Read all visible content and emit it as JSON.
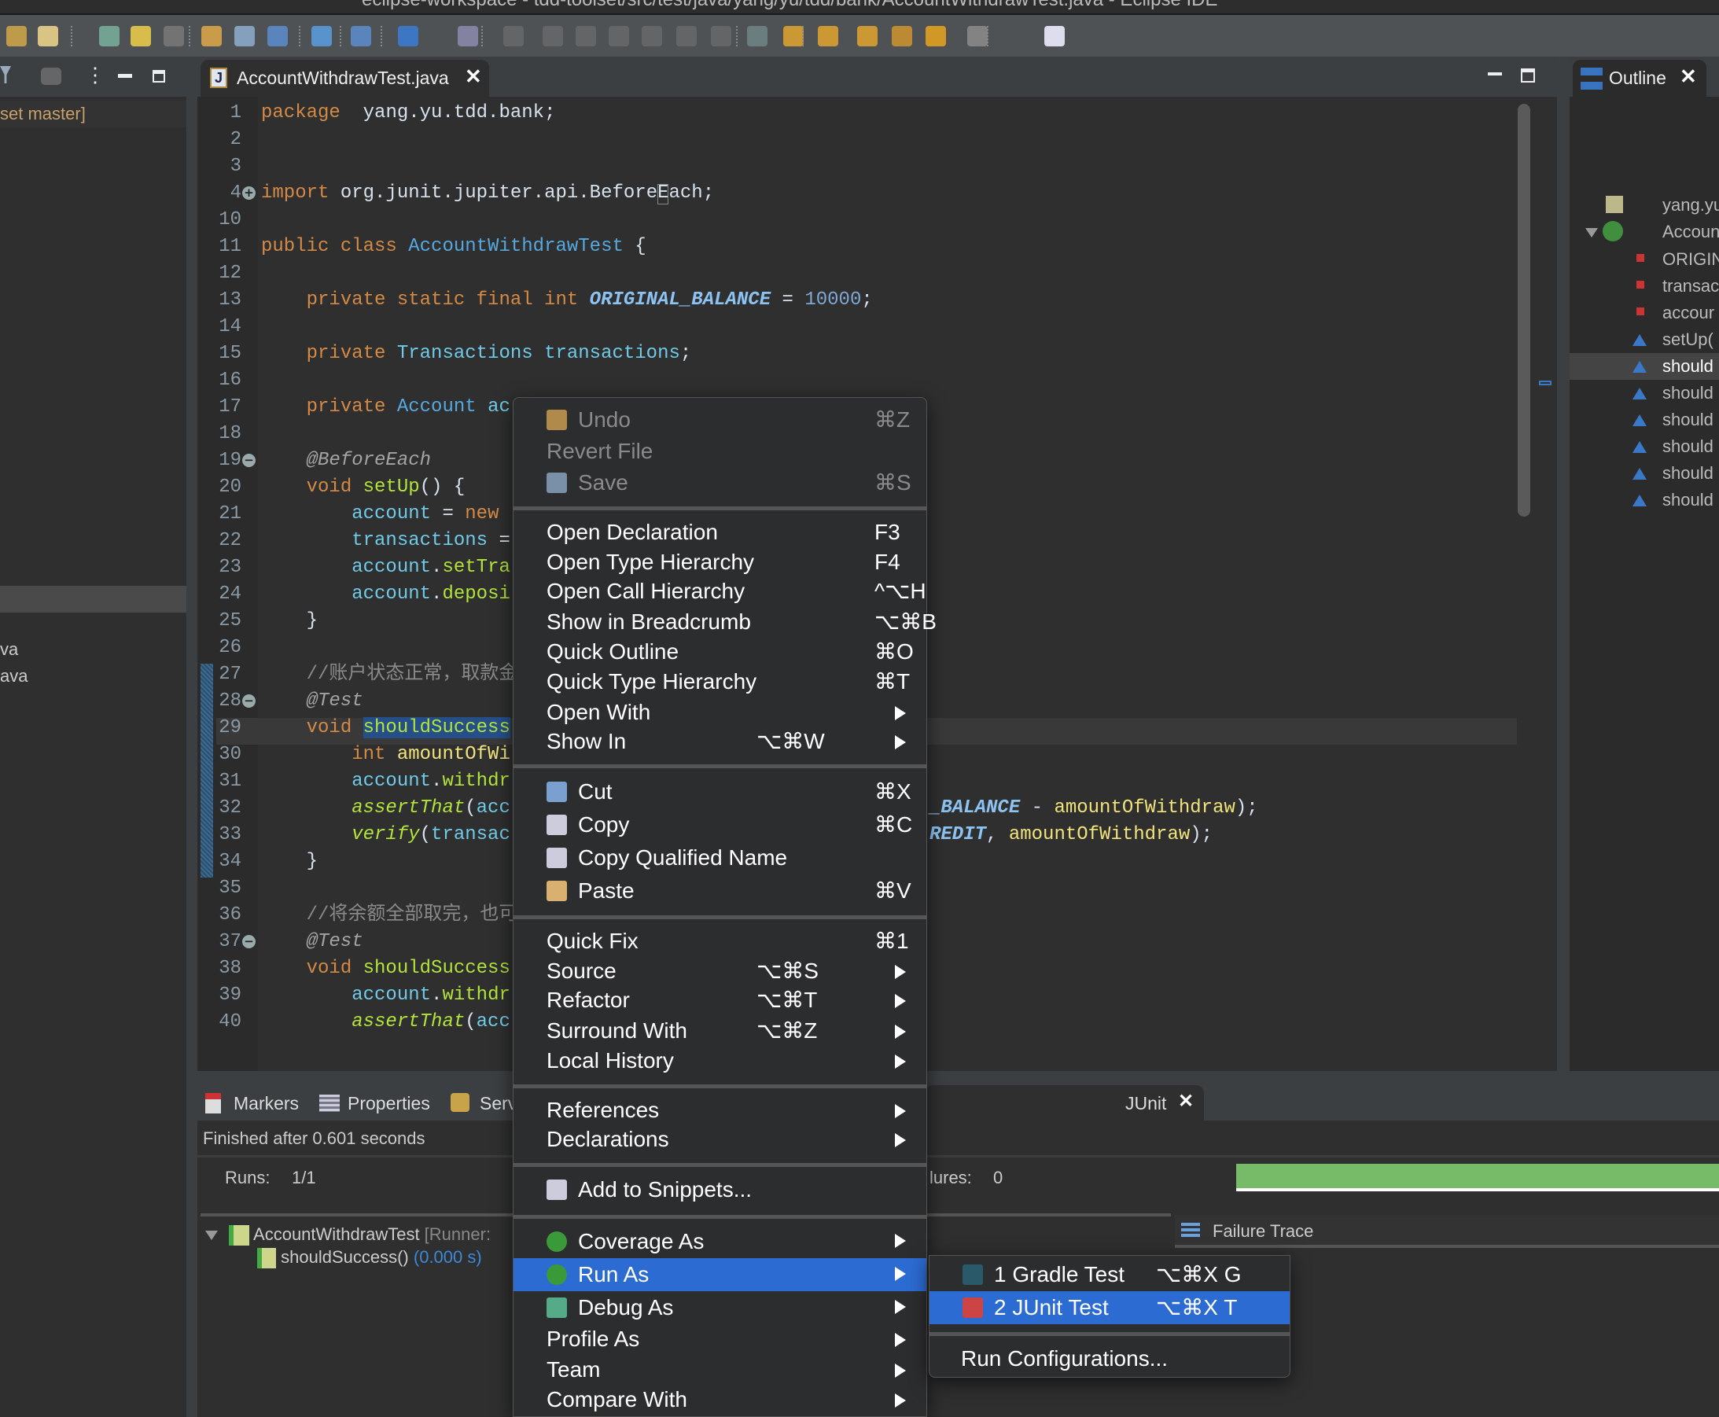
{
  "window": {
    "title": "eclipse-workspace - tdd-toolset/src/test/java/yang/yu/tdd/bank/AccountWithdrawTest.java - Eclipse IDE"
  },
  "toolbar": {
    "icons": [
      "open-icon",
      "pen-icon",
      "new-class-icon",
      "highlight-icon",
      "toggle-icon",
      "next-annotation-icon",
      "block-select-icon",
      "whitespace-icon",
      "globe-icon",
      "run-icon",
      "console-icon",
      "skip-breakpoints-icon",
      "resume-icon",
      "suspend-icon",
      "terminate-icon",
      "disconnect-icon",
      "step-into-icon",
      "step-over-icon",
      "step-return-icon",
      "drop-frame-icon",
      "use-step-filters-icon",
      "next-edit-icon",
      "prev-edit-icon",
      "back-icon",
      "forward-icon",
      "new-window-icon"
    ]
  },
  "left_panel": {
    "rows": [
      "set master]",
      "va",
      "ava"
    ]
  },
  "editor": {
    "tab_label": "AccountWithdrawTest.java",
    "close_glyph": "✕",
    "lines": [
      {
        "n": "1",
        "t": [
          [
            "kw",
            "package"
          ],
          [
            "",
            "  yang.yu.tdd.bank;"
          ]
        ]
      },
      {
        "n": "2",
        "t": []
      },
      {
        "n": "3",
        "t": []
      },
      {
        "n": "4",
        "fold": "+",
        "t": [
          [
            "kw",
            "import"
          ],
          [
            "",
            " org.junit.jupiter.api.BeforeEach;"
          ]
        ]
      },
      {
        "n": "10",
        "t": []
      },
      {
        "n": "11",
        "t": [
          [
            "kw",
            "public class "
          ],
          [
            "cls",
            "AccountWithdrawTest"
          ],
          [
            "",
            " {"
          ]
        ]
      },
      {
        "n": "12",
        "t": []
      },
      {
        "n": "13",
        "t": [
          [
            "",
            "    "
          ],
          [
            "kw",
            "private static final int "
          ],
          [
            "const",
            "ORIGINAL_BALANCE"
          ],
          [
            "",
            " = "
          ],
          [
            "num",
            "10000"
          ],
          [
            "",
            ";"
          ]
        ]
      },
      {
        "n": "14",
        "t": []
      },
      {
        "n": "15",
        "t": [
          [
            "",
            "    "
          ],
          [
            "kw",
            "private "
          ],
          [
            "fld",
            "Transactions"
          ],
          [
            "",
            " "
          ],
          [
            "fld",
            "transactions"
          ],
          [
            "",
            ";"
          ]
        ]
      },
      {
        "n": "16",
        "t": []
      },
      {
        "n": "17",
        "t": [
          [
            "",
            "    "
          ],
          [
            "kw",
            "private "
          ],
          [
            "cls",
            "Account"
          ],
          [
            "",
            " "
          ],
          [
            "fld",
            "ac"
          ]
        ]
      },
      {
        "n": "18",
        "t": []
      },
      {
        "n": "19",
        "fold": "−",
        "t": [
          [
            "",
            "    "
          ],
          [
            "ann",
            "@BeforeEach"
          ]
        ]
      },
      {
        "n": "20",
        "t": [
          [
            "",
            "    "
          ],
          [
            "kw",
            "void "
          ],
          [
            "mth",
            "setUp"
          ],
          [
            "",
            "() {"
          ]
        ]
      },
      {
        "n": "21",
        "t": [
          [
            "",
            "        "
          ],
          [
            "fld",
            "account"
          ],
          [
            "",
            " = "
          ],
          [
            "kw",
            "new"
          ]
        ]
      },
      {
        "n": "22",
        "t": [
          [
            "",
            "        "
          ],
          [
            "fld",
            "transactions"
          ],
          [
            "",
            " ="
          ]
        ]
      },
      {
        "n": "23",
        "t": [
          [
            "",
            "        "
          ],
          [
            "fld",
            "account"
          ],
          [
            "",
            "."
          ],
          [
            "mth",
            "setTra"
          ]
        ]
      },
      {
        "n": "24",
        "t": [
          [
            "",
            "        "
          ],
          [
            "fld",
            "account"
          ],
          [
            "",
            "."
          ],
          [
            "mth",
            "deposi"
          ]
        ]
      },
      {
        "n": "25",
        "t": [
          [
            "",
            "    }"
          ]
        ]
      },
      {
        "n": "26",
        "t": []
      },
      {
        "n": "27",
        "t": [
          [
            "",
            "    "
          ],
          [
            "cmt",
            "//账户状态正常，取款金"
          ]
        ]
      },
      {
        "n": "28",
        "fold": "−",
        "t": [
          [
            "",
            "    "
          ],
          [
            "ann",
            "@Test"
          ]
        ]
      },
      {
        "n": "29",
        "t": [
          [
            "",
            "    "
          ],
          [
            "kw",
            "void "
          ],
          [
            "mth sel",
            "shouldSuccess"
          ]
        ]
      },
      {
        "n": "30",
        "t": [
          [
            "",
            "        "
          ],
          [
            "kw",
            "int "
          ],
          [
            "loc",
            "amountOfWi"
          ]
        ]
      },
      {
        "n": "31",
        "t": [
          [
            "",
            "        "
          ],
          [
            "fld",
            "account"
          ],
          [
            "",
            "."
          ],
          [
            "mth",
            "withdr"
          ]
        ]
      },
      {
        "n": "32",
        "t": [
          [
            "",
            "        "
          ],
          [
            "ital",
            "assertThat"
          ],
          [
            "",
            "("
          ],
          [
            "fld",
            "acc"
          ]
        ],
        "r": [
          [
            "const",
            "_BALANCE"
          ],
          [
            "",
            " - "
          ],
          [
            "loc",
            "amountOfWithdraw"
          ],
          [
            "",
            ");"
          ]
        ]
      },
      {
        "n": "33",
        "t": [
          [
            "",
            "        "
          ],
          [
            "ital",
            "verify"
          ],
          [
            "",
            "("
          ],
          [
            "fld",
            "transac"
          ]
        ],
        "r": [
          [
            "const",
            "REDIT"
          ],
          [
            "",
            ", "
          ],
          [
            "loc",
            "amountOfWithdraw"
          ],
          [
            "",
            ");"
          ]
        ]
      },
      {
        "n": "34",
        "t": [
          [
            "",
            "    }"
          ]
        ]
      },
      {
        "n": "35",
        "t": []
      },
      {
        "n": "36",
        "t": [
          [
            "",
            "    "
          ],
          [
            "cmt",
            "//将余额全部取完，也可"
          ]
        ]
      },
      {
        "n": "37",
        "fold": "−",
        "t": [
          [
            "",
            "    "
          ],
          [
            "ann",
            "@Test"
          ]
        ]
      },
      {
        "n": "38",
        "t": [
          [
            "",
            "    "
          ],
          [
            "kw",
            "void "
          ],
          [
            "mth",
            "shouldSuccess"
          ]
        ]
      },
      {
        "n": "39",
        "t": [
          [
            "",
            "        "
          ],
          [
            "fld",
            "account"
          ],
          [
            "",
            "."
          ],
          [
            "mth",
            "withdr"
          ]
        ]
      },
      {
        "n": "40",
        "t": [
          [
            "",
            "        "
          ],
          [
            "ital",
            "assertThat"
          ],
          [
            "",
            "("
          ],
          [
            "fld",
            "acc"
          ]
        ]
      }
    ]
  },
  "outline": {
    "tab_label": "Outline",
    "rows": [
      {
        "label": "yang.yu.tc",
        "icon": "package-icon"
      },
      {
        "label": "AccountW",
        "icon": "class-icon"
      },
      {
        "label": "ORIGIN",
        "icon": "static-final-field-icon"
      },
      {
        "label": "transac",
        "icon": "private-field-icon"
      },
      {
        "label": "accour",
        "icon": "private-field-icon"
      },
      {
        "label": "setUp(",
        "icon": "method-icon"
      },
      {
        "label": "should",
        "icon": "method-icon",
        "selected": true
      },
      {
        "label": "should",
        "icon": "method-icon"
      },
      {
        "label": "should",
        "icon": "method-icon"
      },
      {
        "label": "should",
        "icon": "method-icon"
      },
      {
        "label": "should",
        "icon": "method-icon"
      },
      {
        "label": "should",
        "icon": "method-icon"
      }
    ]
  },
  "bottom": {
    "tabs": [
      "Markers",
      "Properties",
      "Serv",
      "JUnit"
    ],
    "status": "Finished after 0.601 seconds",
    "runs_label": "Runs:",
    "runs_value": "1/1",
    "failures_label": "lures:",
    "failures_value": "0",
    "progress": 1.0,
    "progress_color": "#77bb69",
    "tree": [
      {
        "label": "AccountWithdrawTest",
        "suffix": " [Runner:"
      },
      {
        "label": "shouldSuccess()",
        "suffix": " (0.000 s)"
      }
    ],
    "failure_trace": "Failure Trace"
  },
  "context_menu": {
    "items": [
      {
        "label": "Undo",
        "sc": "⌘Z",
        "dis": true,
        "icon": "undo-icon"
      },
      {
        "label": "Revert File",
        "dis": true
      },
      {
        "label": "Save",
        "sc": "⌘S",
        "dis": true,
        "icon": "save-icon"
      },
      {
        "sep": true
      },
      {
        "label": "Open Declaration",
        "sc": "F3"
      },
      {
        "label": "Open Type Hierarchy",
        "sc": "F4"
      },
      {
        "label": "Open Call Hierarchy",
        "sc": "^⌥H"
      },
      {
        "label": "Show in Breadcrumb",
        "sc": "⌥⌘B"
      },
      {
        "label": "Quick Outline",
        "sc": "⌘O"
      },
      {
        "label": "Quick Type Hierarchy",
        "sc": "⌘T"
      },
      {
        "label": "Open With",
        "sub": true
      },
      {
        "label": "Show In",
        "sc": "⌥⌘W",
        "sub": true
      },
      {
        "sep": true
      },
      {
        "label": "Cut",
        "sc": "⌘X",
        "icon": "cut-icon"
      },
      {
        "label": "Copy",
        "sc": "⌘C",
        "icon": "copy-icon"
      },
      {
        "label": "Copy Qualified Name",
        "icon": "copy-qualified-name-icon"
      },
      {
        "label": "Paste",
        "sc": "⌘V",
        "icon": "paste-icon"
      },
      {
        "sep": true
      },
      {
        "label": "Quick Fix",
        "sc": "⌘1"
      },
      {
        "label": "Source",
        "sc": "⌥⌘S",
        "sub": true
      },
      {
        "label": "Refactor",
        "sc": "⌥⌘T",
        "sub": true
      },
      {
        "label": "Surround With",
        "sc": "⌥⌘Z",
        "sub": true
      },
      {
        "label": "Local History",
        "sub": true
      },
      {
        "sep": true
      },
      {
        "label": "References",
        "sub": true
      },
      {
        "label": "Declarations",
        "sub": true
      },
      {
        "sep": true
      },
      {
        "label": "Add to Snippets...",
        "icon": "snippets-icon"
      },
      {
        "sep": true
      },
      {
        "label": "Coverage As",
        "sub": true,
        "icon": "coverage-icon"
      },
      {
        "label": "Run As",
        "sub": true,
        "icon": "run-icon",
        "hl": true
      },
      {
        "label": "Debug As",
        "sub": true,
        "icon": "debug-icon"
      },
      {
        "label": "Profile As",
        "sub": true
      },
      {
        "label": "Team",
        "sub": true
      },
      {
        "label": "Compare With",
        "sub": true
      }
    ]
  },
  "run_as_submenu": {
    "items": [
      {
        "label": "1 Gradle Test",
        "sc": "⌥⌘X G",
        "icon": "gradle-icon"
      },
      {
        "label": "2 JUnit Test",
        "sc": "⌥⌘X T",
        "icon": "junit-icon",
        "hl": true
      },
      {
        "sep": true
      },
      {
        "label": "Run Configurations..."
      }
    ]
  },
  "colors": {
    "menu_highlight": "#2c6bd2",
    "editor_bg": "#2f2f2f",
    "keyword": "#d48a45"
  }
}
